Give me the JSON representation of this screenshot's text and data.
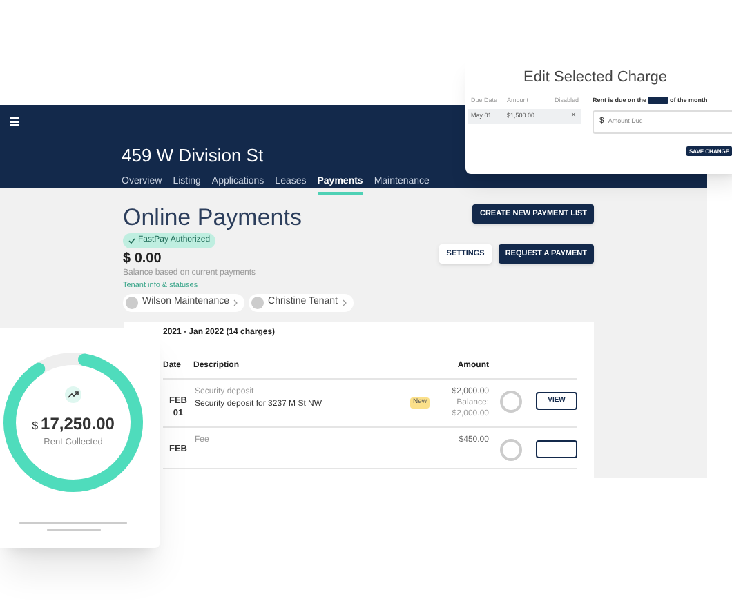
{
  "modal": {
    "title": "Edit Selected Charge",
    "columns": [
      "Due Date",
      "Amount",
      "Disabled"
    ],
    "rows": [
      {
        "due_date": "May 01",
        "amount": "$1,500.00",
        "remove": "×"
      }
    ],
    "due_prefix": "Rent is due on the",
    "due_suffix": "of the month",
    "amount_field": {
      "currency": "$",
      "placeholder": "Amount Due"
    },
    "save_button": "SAVE CHANGE"
  },
  "header": {
    "title": "459 W Division St",
    "tabs": [
      {
        "label": "Overview",
        "selected": false
      },
      {
        "label": "Listing",
        "selected": false
      },
      {
        "label": "Applications",
        "selected": false
      },
      {
        "label": "Leases",
        "selected": false
      },
      {
        "label": "Payments",
        "selected": true
      },
      {
        "label": "Maintenance",
        "selected": false
      }
    ]
  },
  "payments": {
    "title": "Online Payments",
    "badge": "FastPay Authorized",
    "balance": "$ 0.00",
    "balance_note": "Balance based on current payments",
    "tenant_link": "Tenant info & statuses",
    "tenants": [
      "Wilson Maintenance",
      "Christine Tenant"
    ],
    "buttons": [
      {
        "label": "CREATE NEW PAYMENT LIST",
        "kind": "primary"
      },
      {
        "label": "SETTINGS",
        "kind": "plain"
      },
      {
        "label": "REQUEST A PAYMENT",
        "kind": "primary"
      }
    ],
    "table": {
      "title": "2021 - Jan 2022 (14 charges)",
      "columns": [
        "Date",
        "Description",
        "Amount"
      ],
      "rows": [
        {
          "month": "FEB",
          "day": "01",
          "category": "Security deposit",
          "description": "Security deposit for 3237 M St NW",
          "tag": "New",
          "amount": "$2,000.00",
          "balance_label": "Balance:",
          "balance": "$2,000.00",
          "action": "VIEW"
        },
        {
          "month": "FEB",
          "category": "Fee",
          "amount": "$450.00"
        }
      ]
    }
  },
  "rent_card": {
    "level": 0.88,
    "currency": "$",
    "amount": "17,250.00",
    "label": "Rent Collected"
  }
}
